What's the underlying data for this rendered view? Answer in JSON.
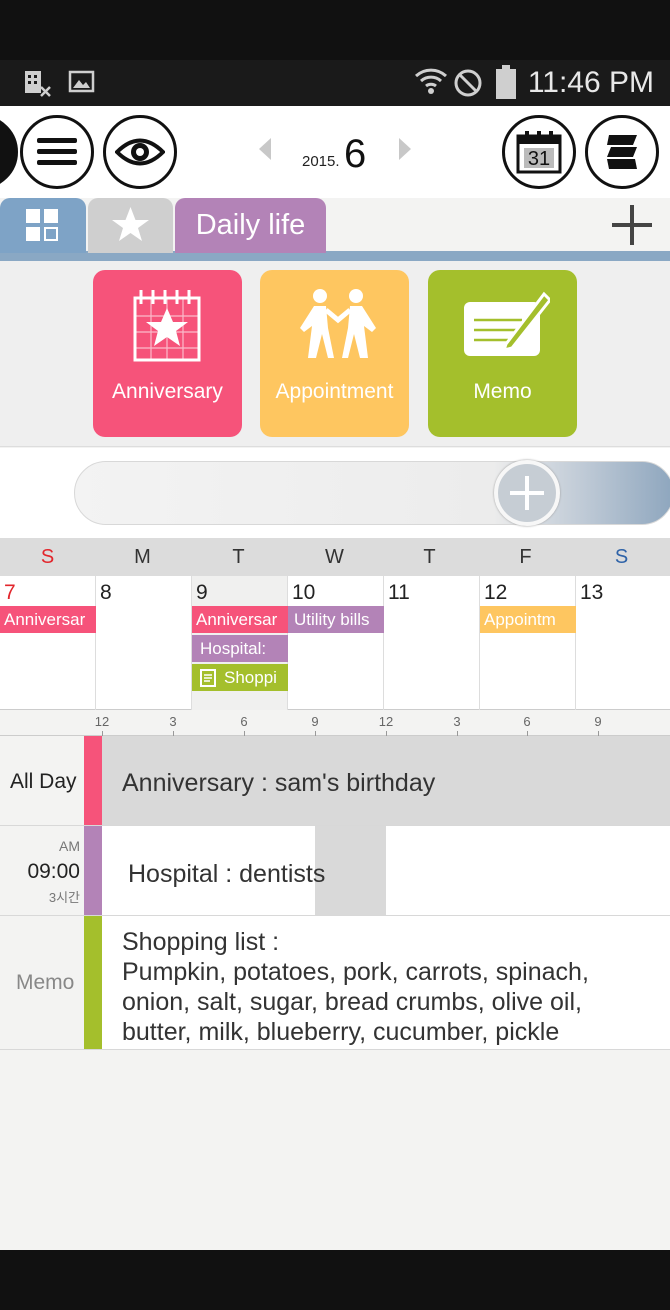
{
  "status_bar": {
    "time": "11:46 PM",
    "icons": [
      "sim-icon",
      "image-icon",
      "wifi-icon",
      "no-disturb-icon",
      "battery-icon"
    ]
  },
  "header": {
    "buttons": [
      "menu-icon",
      "eye-icon",
      "calendar-31-icon",
      "layers-icon"
    ],
    "calendar_icon_day": "31",
    "year": "2015.",
    "month": "6"
  },
  "tabs": {
    "items": [
      {
        "icon": "grid-icon"
      },
      {
        "icon": "star-icon"
      },
      {
        "label": "Daily life"
      }
    ],
    "add_icon": "plus-icon"
  },
  "quick_add": {
    "items": [
      {
        "label": "Anniversary",
        "color": "#f6537a",
        "icon": "anniversary-icon"
      },
      {
        "label": "Appointment",
        "color": "#fec660",
        "icon": "appointment-icon"
      },
      {
        "label": "Memo",
        "color": "#a4bf2c",
        "icon": "memo-icon"
      }
    ]
  },
  "week": {
    "weekdays": [
      "S",
      "M",
      "T",
      "W",
      "T",
      "F",
      "S"
    ],
    "days": [
      {
        "num": "7",
        "events": [
          {
            "text": "Anniversar",
            "color": "pink"
          }
        ]
      },
      {
        "num": "8",
        "events": []
      },
      {
        "num": "9",
        "events": [
          {
            "text": "Anniversar",
            "color": "pink"
          },
          {
            "text": "Hospital:",
            "color": "purple"
          },
          {
            "text": "Shoppi",
            "color": "green"
          }
        ]
      },
      {
        "num": "10",
        "events": [
          {
            "text": "Utility bills",
            "color": "purple"
          }
        ]
      },
      {
        "num": "11",
        "events": []
      },
      {
        "num": "12",
        "events": [
          {
            "text": "Appointm",
            "color": "yellow"
          }
        ]
      },
      {
        "num": "13",
        "events": []
      }
    ]
  },
  "timeline": {
    "ticks": [
      "12",
      "3",
      "6",
      "9",
      "12",
      "3",
      "6",
      "9"
    ]
  },
  "agenda": {
    "allday": {
      "label": "All Day",
      "text": "Anniversary : sam's birthday",
      "color": "#f6537a"
    },
    "hospital": {
      "ampm": "AM",
      "time": "09:00",
      "duration": "3시간",
      "text": "Hospital : dentists",
      "color": "#b383b7"
    },
    "memo": {
      "label": "Memo",
      "line1": "Shopping list  :",
      "line2": "Pumpkin, potatoes, pork, carrots, spinach,",
      "line3": "onion, salt, sugar, bread crumbs, olive oil,",
      "line4": "butter, milk, blueberry, cucumber, pickle",
      "color": "#a4bf2c"
    }
  }
}
